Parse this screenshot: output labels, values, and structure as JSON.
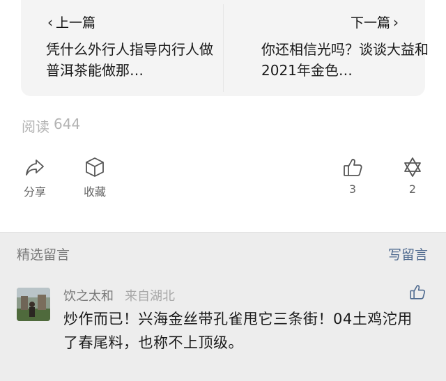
{
  "article_nav": {
    "prev_label": "上一篇",
    "prev_title": "凭什么外行人指导内行人做普洱茶能做那…",
    "next_label": "下一篇",
    "next_title": "你还相信光吗？谈谈大益和2021年金色…"
  },
  "stats": {
    "read_label": "阅读",
    "read_count": "644"
  },
  "actions": {
    "share_label": "分享",
    "favorite_label": "收藏",
    "like_count": "3",
    "wow_count": "2"
  },
  "comments": {
    "section_title": "精选留言",
    "write_label": "写留言",
    "items": [
      {
        "author": "饮之太和",
        "location": "来自湖北",
        "text": "炒作而已！兴海金丝带孔雀甩它三条街！04土鸡沱用了春尾料，也称不上顶级。"
      }
    ]
  },
  "colors": {
    "link_blue": "#4f6a8f",
    "muted_gray": "#b3b3b3",
    "comment_bg": "#ededed",
    "card_bg": "#f4f4f4"
  }
}
